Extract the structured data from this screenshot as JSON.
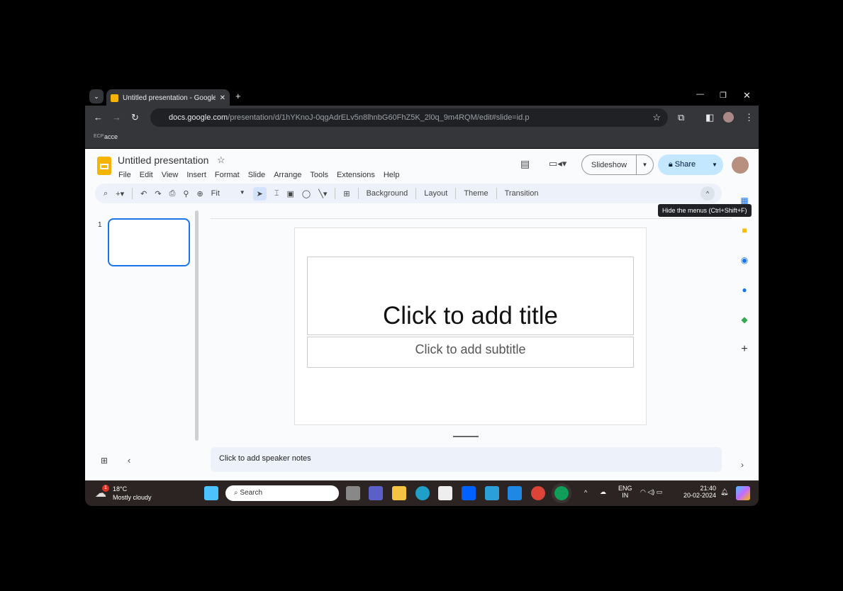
{
  "browser": {
    "tab_title": "Untitled presentation - Google S",
    "url_host": "docs.google.com",
    "url_path": "/presentation/d/1hYKnoJ-0qgAdrELv5n8lhnbG60FhZ5K_2l0q_9m4RQM/edit#slide=id.p",
    "bookmark_icon_label": "ECP",
    "bookmark": "acce"
  },
  "doc": {
    "title": "Untitled presentation",
    "menus": [
      "File",
      "Edit",
      "View",
      "Insert",
      "Format",
      "Slide",
      "Arrange",
      "Tools",
      "Extensions",
      "Help"
    ],
    "slideshow": "Slideshow",
    "share": "Share"
  },
  "toolbar": {
    "zoom": "Fit",
    "background": "Background",
    "layout": "Layout",
    "theme": "Theme",
    "transition": "Transition",
    "tooltip": "Hide the menus (Ctrl+Shift+F)"
  },
  "slides": {
    "number": "1"
  },
  "slide": {
    "title_placeholder": "Click to add title",
    "subtitle_placeholder": "Click to add subtitle"
  },
  "notes": {
    "placeholder": "Click to add speaker notes"
  },
  "taskbar": {
    "weather_temp": "18°C",
    "weather_desc": "Mostly cloudy",
    "weather_badge": "1",
    "search": "Search",
    "lang1": "ENG",
    "lang2": "IN",
    "time": "21:40",
    "date": "20-02-2024"
  }
}
